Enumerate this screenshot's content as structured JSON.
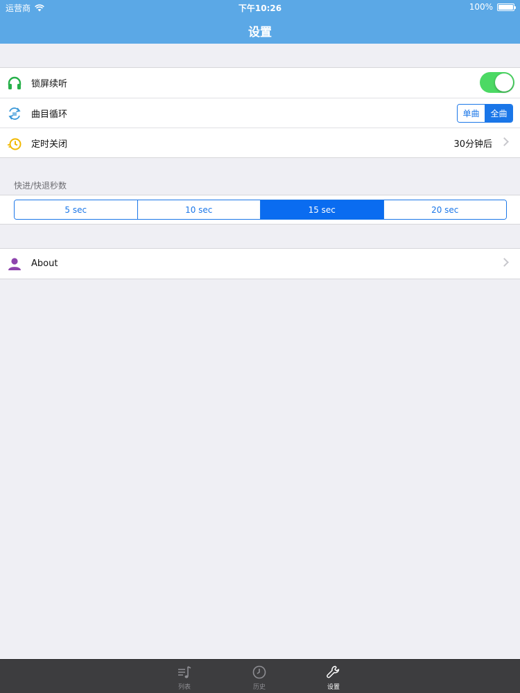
{
  "status_bar": {
    "carrier": "运营商",
    "time": "下午10:26",
    "battery": "100%"
  },
  "nav": {
    "title": "设置"
  },
  "settings": {
    "lock_screen_label": "锁屏续听",
    "lock_screen_on": true,
    "loop_label": "曲目循环",
    "loop_options": [
      "单曲",
      "全曲"
    ],
    "loop_selected": "全曲",
    "timer_label": "定时关闭",
    "timer_value": "30分钟后"
  },
  "seek": {
    "header": "快进/快退秒数",
    "options": [
      "5 sec",
      "10 sec",
      "15 sec",
      "20 sec"
    ],
    "selected": "15 sec"
  },
  "about": {
    "label": "About"
  },
  "tabbar": {
    "tabs": [
      {
        "label": "列表",
        "icon": "music-list-icon"
      },
      {
        "label": "历史",
        "icon": "clock-icon"
      },
      {
        "label": "设置",
        "icon": "wrench-icon"
      }
    ],
    "active": "设置"
  },
  "colors": {
    "nav_bar": "#5ba8e6",
    "accent": "#1a76e8",
    "toggle_on": "#4cd964",
    "tabbar": "#3d3d3f"
  }
}
